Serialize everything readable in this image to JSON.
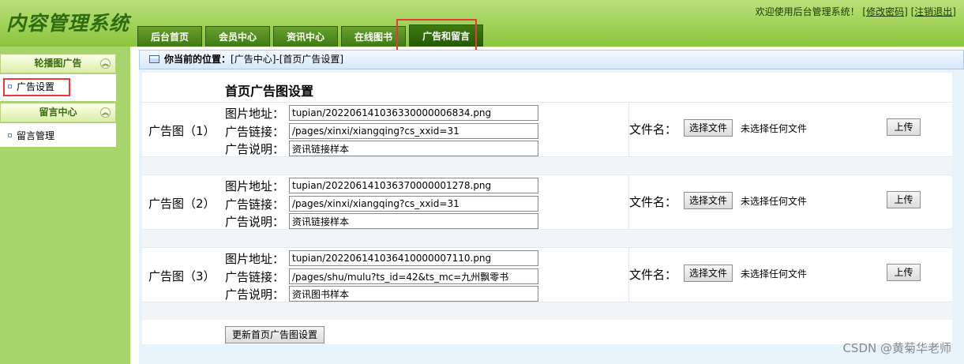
{
  "header": {
    "app_title": "内容管理系统",
    "welcome_prefix": "欢迎使用后台管理系统！",
    "change_password": "[修改密码]",
    "logout": "[注销退出]",
    "tabs": [
      {
        "label": "后台首页"
      },
      {
        "label": "会员中心"
      },
      {
        "label": "资讯中心"
      },
      {
        "label": "在线图书"
      },
      {
        "label": "广告和留言"
      }
    ]
  },
  "sidebar": {
    "groups": [
      {
        "title": "轮播图广告",
        "items": [
          {
            "label": "广告设置"
          }
        ]
      },
      {
        "title": "留言中心",
        "items": [
          {
            "label": "留言管理"
          }
        ]
      }
    ],
    "collapse_glyph": "︽"
  },
  "breadcrumb": {
    "prefix": "你当前的位置：",
    "path": "[广告中心]-[首页广告设置]"
  },
  "main": {
    "title": "首页广告图设置",
    "field_labels": {
      "address": "图片地址：",
      "link": "广告链接：",
      "desc": "广告说明："
    },
    "file_label": "文件名：",
    "choose_file": "选择文件",
    "no_file": "未选择任何文件",
    "upload": "上传",
    "submit": "更新首页广告图设置",
    "ads": [
      {
        "label": "广告图（1）",
        "address": "tupian/20220614103633000000 6834.png",
        "link": "/pages/xinxi/xiangqing?cs_xxid=31",
        "desc": "资讯链接样本"
      },
      {
        "label": "广告图（2）",
        "address": "tupian/20220614103637000000 1278.png",
        "link": "/pages/xinxi/xiangqing?cs_xxid=31",
        "desc": "资讯链接样本"
      },
      {
        "label": "广告图（3）",
        "address": "tupian/20220614103641000000 7110.png",
        "link": "/pages/shu/mulu?ts_id=42&ts_mc=九州飘零书",
        "desc": "资讯图书样本"
      }
    ]
  },
  "watermark": "CSDN @黄菊华老师"
}
